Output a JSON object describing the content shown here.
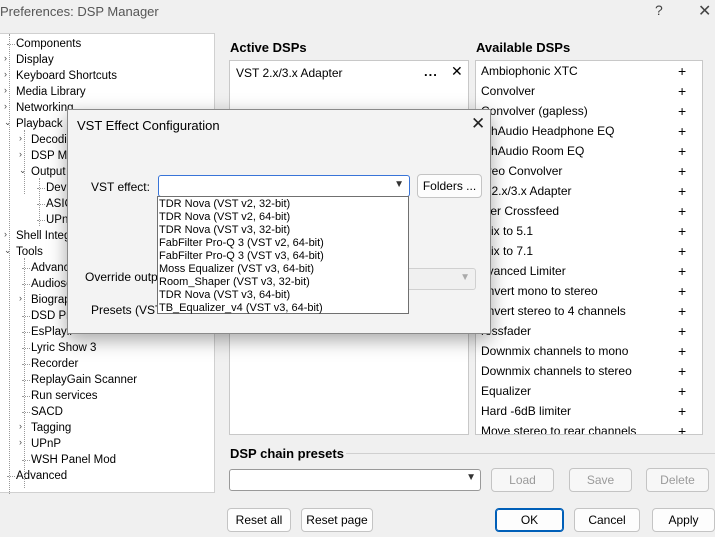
{
  "window": {
    "title": "Preferences: DSP Manager",
    "help_label": "?",
    "close_label": "✕"
  },
  "tree": [
    {
      "label": "Components"
    },
    {
      "label": "Display"
    },
    {
      "label": "Keyboard Shortcuts"
    },
    {
      "label": "Media Library"
    },
    {
      "label": "Networking"
    },
    {
      "label": "Playback"
    },
    {
      "label": "Decodin"
    },
    {
      "label": "DSP Ma"
    },
    {
      "label": "Output"
    },
    {
      "label": "Devi"
    },
    {
      "label": "ASIC"
    },
    {
      "label": "UPnl"
    },
    {
      "label": "Shell Integ"
    },
    {
      "label": "Tools"
    },
    {
      "label": "Advanc"
    },
    {
      "label": "Audiosc"
    },
    {
      "label": "Biograp"
    },
    {
      "label": "DSD Pro"
    },
    {
      "label": "EsPlayli"
    },
    {
      "label": "Lyric Show 3"
    },
    {
      "label": "Recorder"
    },
    {
      "label": "ReplayGain Scanner"
    },
    {
      "label": "Run services"
    },
    {
      "label": "SACD"
    },
    {
      "label": "Tagging"
    },
    {
      "label": "UPnP"
    },
    {
      "label": "WSH Panel Mod"
    },
    {
      "label": "Advanced"
    }
  ],
  "active": {
    "heading": "Active DSPs",
    "items": [
      {
        "label": "VST 2.x/3.x Adapter",
        "config_label": "...",
        "remove_label": "✕"
      }
    ]
  },
  "available": {
    "heading": "Available DSPs",
    "add_label": "+",
    "items": [
      "Ambiophonic XTC",
      "Convolver",
      "Convolver (gapless)",
      "athAudio Headphone EQ",
      "athAudio Room EQ",
      "ereo Convolver",
      "T 2.x/3.x Adapter",
      "eier Crossfeed",
      "mix to 5.1",
      "mix to 7.1",
      "dvanced Limiter",
      "onvert mono to stereo",
      "onvert stereo to 4 channels",
      "rossfader",
      "Downmix channels to mono",
      "Downmix channels to stereo",
      "Equalizer",
      "Hard -6dB limiter",
      "Move stereo to rear channels"
    ]
  },
  "presets": {
    "heading": "DSP chain presets",
    "combo_value": "",
    "load_label": "Load",
    "save_label": "Save",
    "delete_label": "Delete"
  },
  "footer": {
    "reset_all_label": "Reset all",
    "reset_page_label": "Reset page",
    "ok_label": "OK",
    "cancel_label": "Cancel",
    "apply_label": "Apply"
  },
  "dialog": {
    "title": "VST Effect Configuration",
    "close_label": "✕",
    "vst_label": "VST effect:",
    "vst_value": "",
    "folders_label": "Folders ...",
    "override_label": "Override outpu",
    "presets_label": "Presets (VST3",
    "options": [
      "TDR Nova (VST v2, 32-bit)",
      "TDR Nova (VST v2, 64-bit)",
      "TDR Nova (VST v3, 32-bit)",
      "FabFilter Pro-Q 3 (VST v2, 64-bit)",
      "FabFilter Pro-Q 3 (VST v3, 64-bit)",
      "Moss Equalizer (VST v3, 64-bit)",
      "Room_Shaper (VST v3, 32-bit)",
      "TDR Nova (VST v3, 64-bit)",
      "TB_Equalizer_v4 (VST v3, 64-bit)"
    ]
  }
}
